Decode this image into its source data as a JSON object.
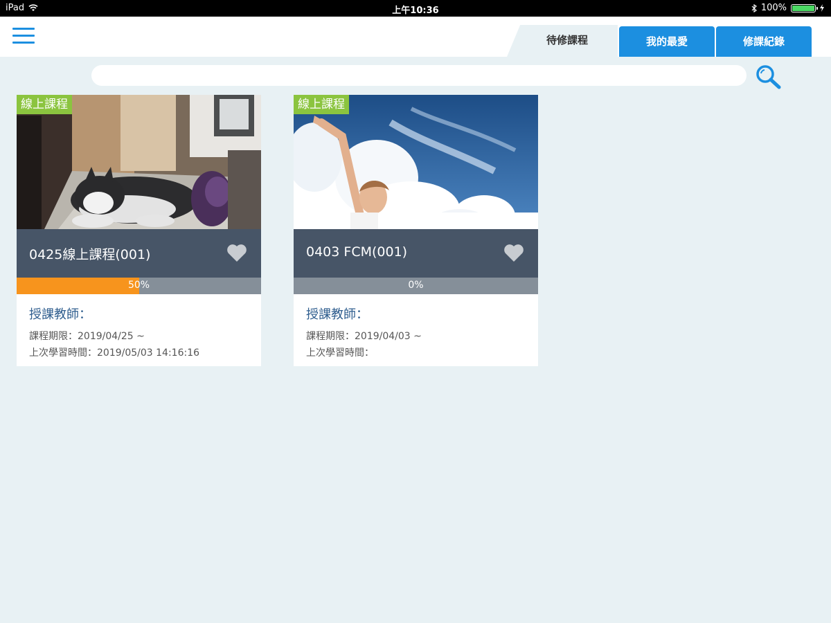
{
  "status_bar": {
    "device": "iPad",
    "time": "上午10:36",
    "battery_text": "100%",
    "battery_level": 1.0,
    "battery_color": "#4cd964"
  },
  "header": {
    "menu_icon": "hamburger-menu-icon",
    "tabs": [
      {
        "label": "待修課程",
        "active": true
      },
      {
        "label": "我的最愛",
        "active": false
      },
      {
        "label": "修課紀錄",
        "active": false
      }
    ],
    "accent_color": "#1c8fe0"
  },
  "search": {
    "value": "",
    "icon": "search-icon"
  },
  "courses": [
    {
      "badge": "線上課程",
      "title": "0425線上課程(001)",
      "progress_text": "50%",
      "progress": 0.5,
      "teacher_label": "授課教師：",
      "period": "課程期限：2019/04/25 ~",
      "last_study": "上次學習時間：2019/05/03 14:16:16",
      "favorite_icon": "heart-icon"
    },
    {
      "badge": "線上課程",
      "title": "0403 FCM(001)",
      "progress_text": "0%",
      "progress": 0,
      "teacher_label": "授課教師：",
      "period": "課程期限：2019/04/03 ~",
      "last_study": "上次學習時間：",
      "favorite_icon": "heart-icon"
    }
  ],
  "colors": {
    "badge": "#8bc43f",
    "title_bar": "#475567",
    "progress_fill": "#f7941d",
    "progress_track": "#858f99",
    "background": "#e8f1f4"
  }
}
